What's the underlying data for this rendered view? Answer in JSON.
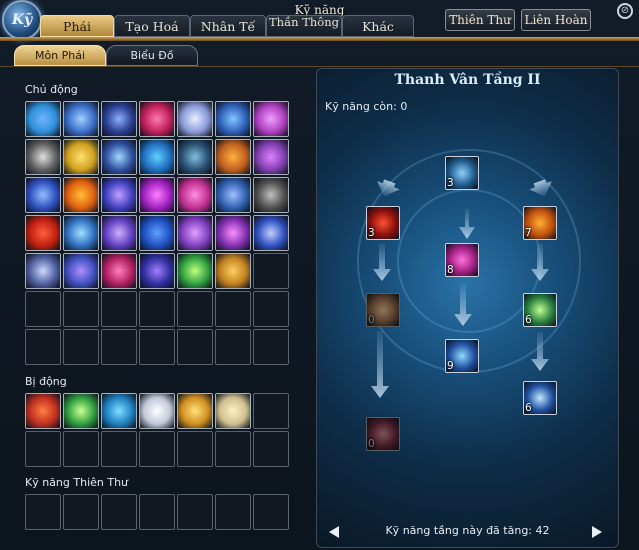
{
  "window": {
    "title": "Kỹ năng",
    "logo_text": "Kỹ",
    "close_symbol": "⊘"
  },
  "main_tabs": [
    {
      "label": "Phái",
      "active": true
    },
    {
      "label": "Tạo Hoá",
      "active": false
    },
    {
      "label": "Nhân Tế",
      "active": false
    },
    {
      "label": "Thần Thông",
      "active": false
    },
    {
      "label": "Khác",
      "active": false
    }
  ],
  "right_buttons": [
    {
      "label": "Thiên Thư"
    },
    {
      "label": "Liên Hoàn"
    }
  ],
  "sub_tabs": [
    {
      "label": "Môn Phái",
      "active": true
    },
    {
      "label": "Biểu Đồ",
      "active": false
    }
  ],
  "sections": {
    "active": {
      "label": "Chủ động",
      "rows": 7,
      "cols": 7
    },
    "passive": {
      "label": "Bị động",
      "rows": 2,
      "cols": 7
    },
    "heaven_book": {
      "label": "Kỹ năng Thiên Thư",
      "rows": 1,
      "cols": 7
    }
  },
  "active_icons": [
    [
      "#2f8fd8",
      "#6fb6ff"
    ],
    [
      "#3a6ec8",
      "#9ed2ff"
    ],
    [
      "#2a3e90",
      "#8db0ff"
    ],
    [
      "#c0205a",
      "#ff7ab0"
    ],
    [
      "#8a9ad8",
      "#e8f0ff"
    ],
    [
      "#3060b8",
      "#80c8ff"
    ],
    [
      "#b040c0",
      "#f0a0ff"
    ],
    [
      "#606060",
      "#e0e0e0"
    ],
    [
      "#d0a020",
      "#ffe070"
    ],
    [
      "#3050a0",
      "#a0d8ff"
    ],
    [
      "#2070c0",
      "#60d0ff"
    ],
    [
      "#2a5070",
      "#80c0e0"
    ],
    [
      "#c06020",
      "#ffb040"
    ],
    [
      "#8040b0",
      "#e080ff"
    ],
    [
      "#3050c0",
      "#90c0ff"
    ],
    [
      "#e06010",
      "#ffc030"
    ],
    [
      "#4040c0",
      "#c0a0ff"
    ],
    [
      "#a020c0",
      "#ff80ff"
    ],
    [
      "#c03090",
      "#ff90e0"
    ],
    [
      "#3060b0",
      "#a0c0ff"
    ],
    [
      "#505050",
      "#c0c0c0"
    ],
    [
      "#c02010",
      "#ff6040"
    ],
    [
      "#3070c0",
      "#a0e0ff"
    ],
    [
      "#6040c0",
      "#d0b0ff"
    ],
    [
      "#2050c0",
      "#60a0ff"
    ],
    [
      "#8040c0",
      "#e0a0ff"
    ],
    [
      "#8030b0",
      "#ff90ff"
    ],
    [
      "#3050c0",
      "#c0d0ff"
    ],
    [
      "#5060a0",
      "#d0d8ff"
    ],
    [
      "#4050c0",
      "#b090ff"
    ],
    [
      "#b02060",
      "#ff80c0"
    ],
    [
      "#3030a0",
      "#a080ff"
    ],
    [
      "#30a040",
      "#c0ff80"
    ],
    [
      "#c08020",
      "#ffd060"
    ]
  ],
  "passive_icons": [
    [
      "#c03020",
      "#ff8040"
    ],
    [
      "#30a040",
      "#d0ff90"
    ],
    [
      "#2080c0",
      "#80e0ff"
    ],
    [
      "#c0c8d8",
      "#ffffff"
    ],
    [
      "#d09020",
      "#ffe080"
    ],
    [
      "#d0c090",
      "#fff0c0"
    ]
  ],
  "skill_tree": {
    "title": "Thanh Vân Tầng II",
    "remaining_label": "Kỹ năng còn:",
    "remaining_value": "0",
    "footer_label": "Kỹ năng tầng này đã tăng:",
    "footer_value": "42",
    "nodes": [
      {
        "id": "top",
        "level": "3",
        "colors": [
          "#1e5a8a",
          "#8fd0ff"
        ],
        "dim": false
      },
      {
        "id": "left1",
        "level": "3",
        "colors": [
          "#8a1010",
          "#ff5030"
        ],
        "dim": false
      },
      {
        "id": "right1",
        "level": "7",
        "colors": [
          "#c05010",
          "#ffb030"
        ],
        "dim": false
      },
      {
        "id": "mid",
        "level": "8",
        "colors": [
          "#a02080",
          "#ff70e0"
        ],
        "dim": false
      },
      {
        "id": "left2",
        "level": "0",
        "colors": [
          "#a05010",
          "#ffa040"
        ],
        "dim": true
      },
      {
        "id": "right2",
        "level": "6",
        "colors": [
          "#2a8040",
          "#c0ff90"
        ],
        "dim": false
      },
      {
        "id": "mid2",
        "level": "9",
        "colors": [
          "#2050a0",
          "#90d8ff"
        ],
        "dim": false
      },
      {
        "id": "right3",
        "level": "6",
        "colors": [
          "#2050a0",
          "#c0e8ff"
        ],
        "dim": false
      },
      {
        "id": "left3",
        "level": "0",
        "colors": [
          "#a01040",
          "#ff6080"
        ],
        "dim": true
      }
    ]
  }
}
